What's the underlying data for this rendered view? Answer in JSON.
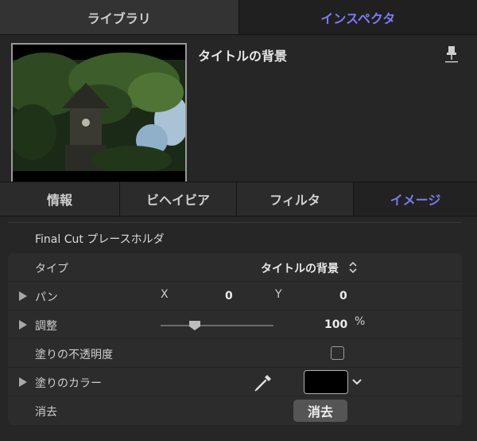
{
  "top_tabs": {
    "library": "ライブラリ",
    "inspector": "インスペクタ"
  },
  "header": {
    "title": "タイトルの背景"
  },
  "sub_tabs": {
    "info": "情報",
    "behavior": "ビヘイビア",
    "filter": "フィルタ",
    "image": "イメージ"
  },
  "section": {
    "title": "Final Cut プレースホルダ"
  },
  "params": {
    "type": {
      "label": "タイプ",
      "value": "タイトルの背景"
    },
    "pan": {
      "label": "パン",
      "x_label": "X",
      "x_value": "0",
      "y_label": "Y",
      "y_value": "0"
    },
    "adjust": {
      "label": "調整",
      "value": "100",
      "unit": "%",
      "level": 0.3
    },
    "fill_opacity": {
      "label": "塗りの不透明度",
      "checked": false
    },
    "fill_color": {
      "label": "塗りのカラー",
      "color": "#000000"
    },
    "clear": {
      "label": "消去",
      "button_label": "消去"
    }
  },
  "colors": {
    "accent": "#7b7cf2",
    "background": "#262626",
    "panel": "#2c2c2c"
  },
  "icons": [
    "pin-icon",
    "updown-arrows-icon",
    "disclosure-triangle-icon",
    "eyedropper-icon",
    "chevron-down-icon"
  ]
}
